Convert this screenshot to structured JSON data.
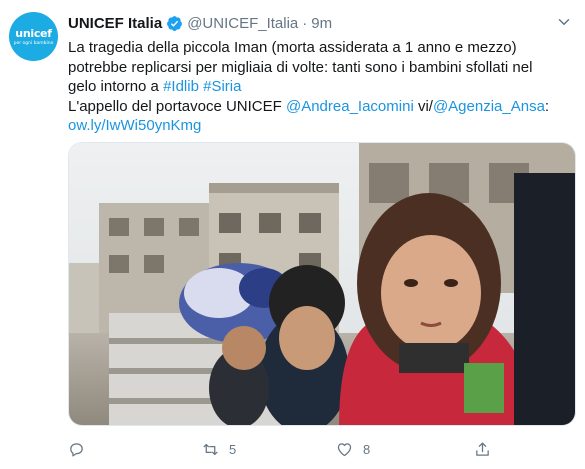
{
  "tweet": {
    "avatar": {
      "logo_text": "unicef",
      "logo_subtext": "per ogni bambino"
    },
    "author_name": "UNICEF Italia",
    "handle": "@UNICEF_Italia",
    "separator": "·",
    "time": "9m",
    "text": {
      "line1": "La tragedia della piccola Iman (morta assiderata a 1 anno e mezzo)",
      "line2": "potrebbe replicarsi per migliaia di volte: tanti sono i bambini sfollati nel",
      "line3_prefix": "gelo intorno a ",
      "hashtag1": "#Idlib",
      "hashtag2": "#Siria",
      "line4_prefix": "L'appello del portavoce UNICEF ",
      "mention1": "@Andrea_Iacomini",
      "via": " vi/",
      "mention2": "@Agenzia_Ansa",
      "line4_suffix": ":",
      "short_link": "ow.ly/IwWi50ynKmg"
    },
    "actions": {
      "reply_icon": "reply-icon",
      "retweet_icon": "retweet-icon",
      "retweet_count": "5",
      "like_icon": "heart-icon",
      "like_count": "8",
      "share_icon": "share-icon"
    },
    "colors": {
      "link": "#1b95e0",
      "muted": "#657786",
      "unicef_blue": "#1cabe2"
    }
  }
}
